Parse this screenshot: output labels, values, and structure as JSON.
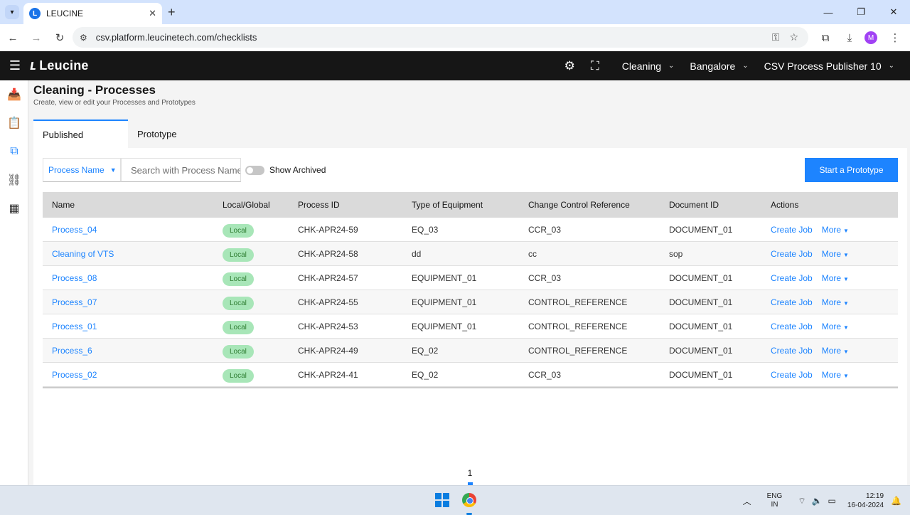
{
  "browser": {
    "tab_title": "LEUCINE",
    "url": "csv.platform.leucinetech.com/checklists",
    "profile_initial": "M"
  },
  "header": {
    "brand": "Leucine",
    "facility": "Cleaning",
    "location": "Bangalore",
    "user": "CSV Process Publisher 10"
  },
  "page": {
    "title": "Cleaning - Processes",
    "subtitle": "Create, view or edit your Processes and Prototypes",
    "tabs": [
      "Published",
      "Prototype"
    ]
  },
  "filters": {
    "field": "Process Name",
    "search_placeholder": "Search with Process Name",
    "show_archived": "Show Archived",
    "start_button": "Start a Prototype"
  },
  "table": {
    "columns": [
      "Name",
      "Local/Global",
      "Process ID",
      "Type of Equipment",
      "Change Control Reference",
      "Document ID",
      "Actions"
    ],
    "rows": [
      {
        "name": "Process_04",
        "scope": "Local",
        "id": "CHK-APR24-59",
        "equipment": "EQ_03",
        "ccr": "CCR_03",
        "doc": "DOCUMENT_01",
        "action": "Create Job",
        "more": "More"
      },
      {
        "name": "Cleaning of VTS",
        "scope": "Local",
        "id": "CHK-APR24-58",
        "equipment": "dd",
        "ccr": "cc",
        "doc": "sop",
        "action": "Create Job",
        "more": "More"
      },
      {
        "name": "Process_08",
        "scope": "Local",
        "id": "CHK-APR24-57",
        "equipment": "EQUIPMENT_01",
        "ccr": "CCR_03",
        "doc": "DOCUMENT_01",
        "action": "Create Job",
        "more": "More"
      },
      {
        "name": "Process_07",
        "scope": "Local",
        "id": "CHK-APR24-55",
        "equipment": "EQUIPMENT_01",
        "ccr": "CONTROL_REFERENCE",
        "doc": "DOCUMENT_01",
        "action": "Create Job",
        "more": "More"
      },
      {
        "name": "Process_01",
        "scope": "Local",
        "id": "CHK-APR24-53",
        "equipment": "EQUIPMENT_01",
        "ccr": "CONTROL_REFERENCE",
        "doc": "DOCUMENT_01",
        "action": "Create Job",
        "more": "More"
      },
      {
        "name": "Process_6",
        "scope": "Local",
        "id": "CHK-APR24-49",
        "equipment": "EQ_02",
        "ccr": "CONTROL_REFERENCE",
        "doc": "DOCUMENT_01",
        "action": "Create Job",
        "more": "More"
      },
      {
        "name": "Process_02",
        "scope": "Local",
        "id": "CHK-APR24-41",
        "equipment": "EQ_02",
        "ccr": "CCR_03",
        "doc": "DOCUMENT_01",
        "action": "Create Job",
        "more": "More"
      }
    ]
  },
  "pagination": {
    "current_page": "1"
  },
  "taskbar": {
    "lang_top": "ENG",
    "lang_bottom": "IN",
    "time": "12:19",
    "date": "16-04-2024"
  },
  "colors": {
    "accent": "#1d84ff",
    "header_bg": "#161616",
    "badge_bg": "#a8e6b8"
  }
}
